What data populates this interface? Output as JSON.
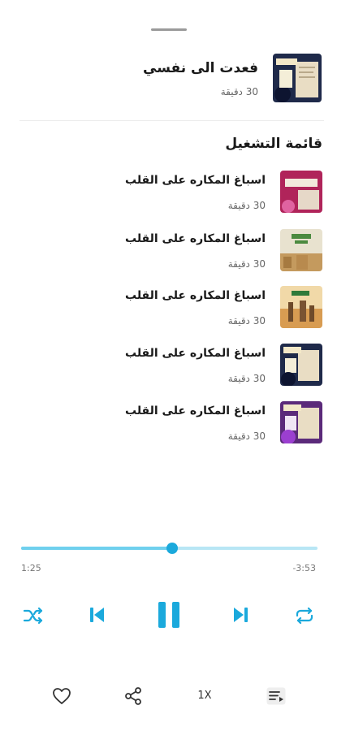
{
  "now_playing": {
    "title": "فعدت الى نفسي",
    "duration": "30 دقيقة"
  },
  "playlist": {
    "heading": "قائمة التشغيل",
    "items": [
      {
        "title": "اسباغ المكاره على القلب",
        "duration": "30 دقيقة",
        "art": "pink"
      },
      {
        "title": "اسباغ المكاره على القلب",
        "duration": "30 دقيقة",
        "art": "green"
      },
      {
        "title": "اسباغ المكاره على القلب",
        "duration": "30 دقيقة",
        "art": "orange"
      },
      {
        "title": "اسباغ المكاره على القلب",
        "duration": "30 دقيقة",
        "art": "navy"
      },
      {
        "title": "اسباغ المكاره على القلب",
        "duration": "30 دقيقة",
        "art": "purple"
      }
    ]
  },
  "player": {
    "elapsed": "1:25",
    "remaining": "-3:53",
    "progress": 0.51,
    "speed": "1X",
    "accent_color": "#1ba9dc"
  },
  "icons": {
    "shuffle": "shuffle-icon",
    "previous": "skip-previous-icon",
    "pause": "pause-icon",
    "next": "skip-next-icon",
    "repeat": "repeat-icon",
    "favorite": "heart-icon",
    "share": "share-icon",
    "queue": "queue-icon"
  }
}
